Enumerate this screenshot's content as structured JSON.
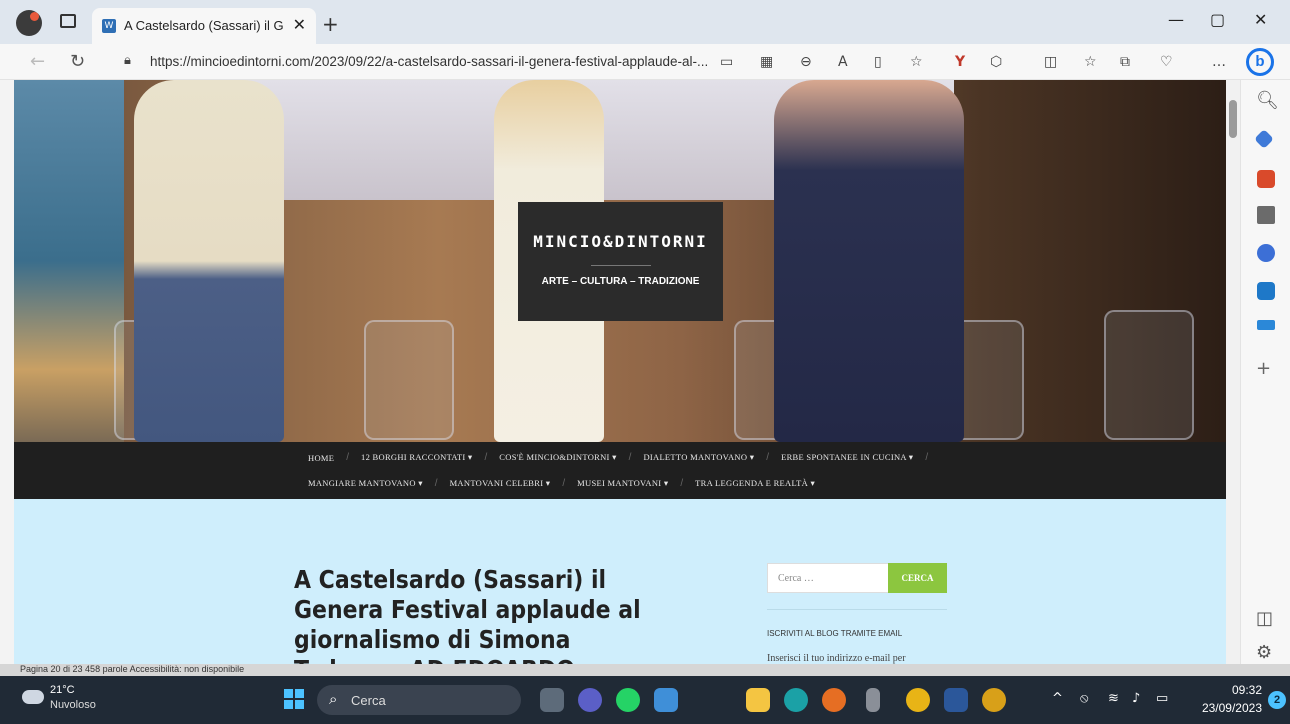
{
  "browser": {
    "tab_title": "A Castelsardo (Sassari) il Genera",
    "tab_close": "✕",
    "new_tab": "+",
    "url": "https://mincioedintorni.com/2023/09/22/a-castelsardo-sassari-il-genera-festival-applaude-al-...",
    "minimize": "—",
    "maximize": "▢",
    "close": "✕"
  },
  "site": {
    "title": "MINCIO&DINTORNI",
    "tagline": "ARTE – CULTURA – TRADIZIONE",
    "menu_row1": [
      "HOME",
      "12 BORGHI RACCONTATI ▾",
      "COS'È MINCIO&DINTORNI ▾",
      "DIALETTO MANTOVANO ▾",
      "ERBE SPONTANEE IN CUCINA ▾"
    ],
    "menu_row2": [
      "MANGIARE MANTOVANO ▾",
      "MANTOVANI CELEBRI ▾",
      "MUSEI MANTOVANI ▾",
      "TRA LEGGENDA E REALTÀ ▾"
    ]
  },
  "post": {
    "title": "A Castelsardo (Sassari) il Genera Festival applaude al giornalismo di Simona Tedesco- AD EDOARDO RASPELLI IL"
  },
  "sidebar_widget": {
    "search_placeholder": "Cerca …",
    "search_button": "CERCA",
    "subscribe_title": "ISCRIVITI AL BLOG TRAMITE EMAIL",
    "subscribe_text": "Inserisci il tuo indirizzo e-mail per"
  },
  "statusbar": {
    "text": "Pagina 20 di 23     458 parole     Accessibilità: non disponibile"
  },
  "taskbar": {
    "temperature": "21°C",
    "condition": "Nuvoloso",
    "search_label": "Cerca",
    "time": "09:32",
    "date": "23/09/2023",
    "notifications": "2"
  },
  "colors": {
    "menu_bg": "#1f1f1f",
    "content_bg": "#cfeefc",
    "search_button": "#8cc63f",
    "taskbar_bg": "#202a36"
  }
}
